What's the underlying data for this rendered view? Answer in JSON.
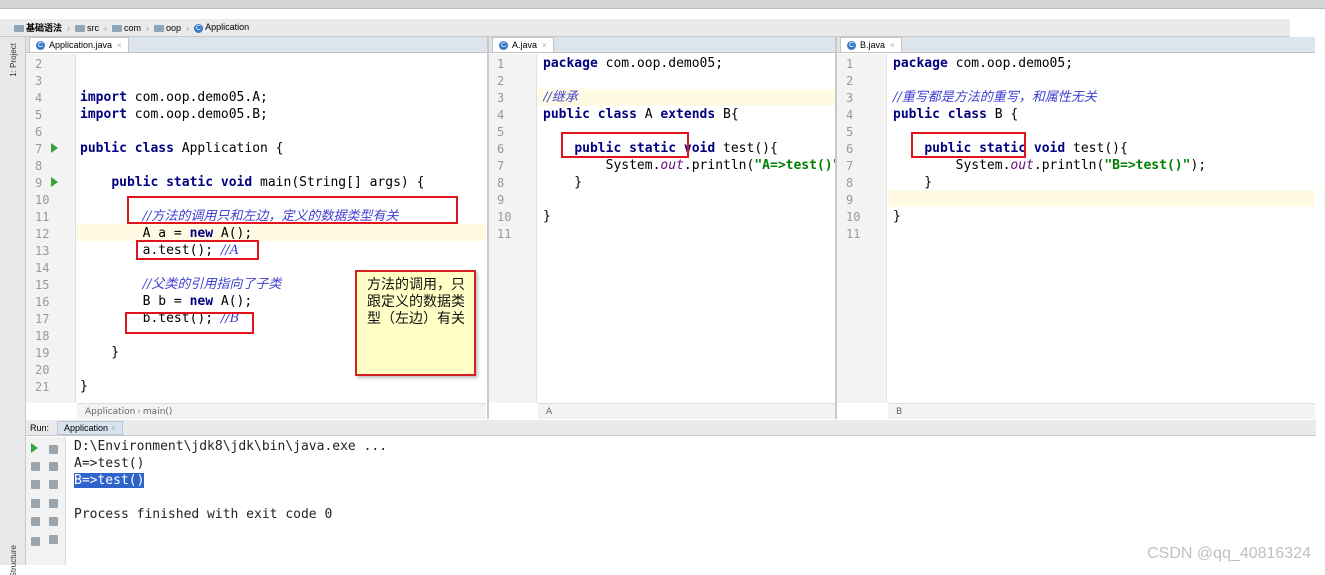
{
  "breadcrumb": [
    "基础语法",
    "src",
    "com",
    "oop",
    "Application"
  ],
  "sidebar": {
    "project_tab": "1: Project",
    "structure_tab": "Structure"
  },
  "pane1": {
    "tab": "Application.java",
    "line_numbers": [
      "2",
      "3",
      "4",
      "5",
      "6",
      "7",
      "8",
      "9",
      "10",
      "11",
      "12",
      "13",
      "14",
      "15",
      "16",
      "17",
      "18",
      "19",
      "20",
      "21"
    ],
    "bottom_crumb": [
      "Application",
      "main()"
    ]
  },
  "pane2": {
    "tab": "A.java",
    "line_numbers": [
      "1",
      "2",
      "3",
      "4",
      "5",
      "6",
      "7",
      "8",
      "9",
      "10",
      "11"
    ],
    "bottom_crumb": "A"
  },
  "pane3": {
    "tab": "B.java",
    "line_numbers": [
      "1",
      "2",
      "3",
      "4",
      "5",
      "6",
      "7",
      "8",
      "9",
      "10",
      "11"
    ],
    "bottom_crumb": "B"
  },
  "run": {
    "label": "Run:",
    "tab": "Application",
    "lines": [
      "D:\\Environment\\jdk8\\jdk\\bin\\java.exe ...",
      "A=>test()",
      "B=>test()",
      "",
      "Process finished with exit code 0"
    ]
  },
  "note": "方法的调用，只跟定义的数据类型（左边）有关",
  "watermark": "CSDN @qq_40816324",
  "colors": {
    "keyword": "#000080",
    "comment": "#3f3fd0",
    "string": "#008000",
    "highlight_box": "#e0141a",
    "note_bg": "#ffffc6"
  }
}
